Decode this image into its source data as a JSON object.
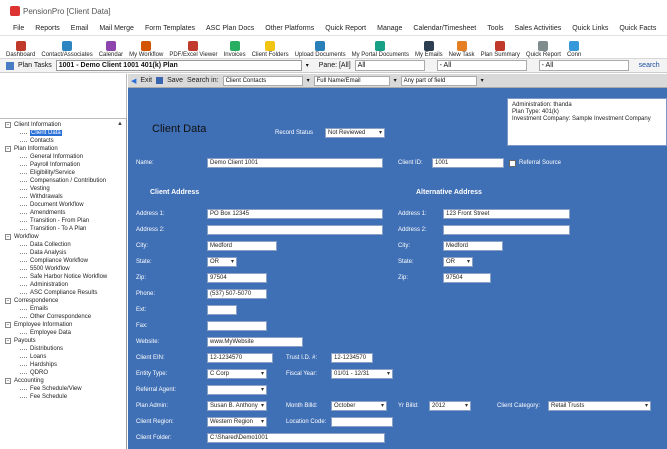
{
  "window": {
    "title": "PensionPro  [Client Data]"
  },
  "menu": [
    "File",
    "Reports",
    "Email",
    "Mail Merge",
    "Form Templates",
    "ASC Plan Docs",
    "Other Platforms",
    "Quick Report",
    "Manage",
    "Calendar/Timesheet",
    "Tools",
    "Sales Activities",
    "Quick Links",
    "Quick Facts"
  ],
  "toolbar": [
    {
      "label": "Dashboard",
      "icon": "dashboard-icon",
      "color": "#c0392b"
    },
    {
      "label": "Contact/Associates",
      "icon": "contacts-icon",
      "color": "#2e86c1"
    },
    {
      "label": "Calendar",
      "icon": "calendar-icon",
      "color": "#8e44ad"
    },
    {
      "label": "My Workflow",
      "icon": "workflow-icon",
      "color": "#d35400"
    },
    {
      "label": "PDF/Excel Viewer",
      "icon": "pdf-icon",
      "color": "#c0392b"
    },
    {
      "label": "Invoices",
      "icon": "invoice-icon",
      "color": "#27ae60"
    },
    {
      "label": "Client Folders",
      "icon": "folder-icon",
      "color": "#f1c40f"
    },
    {
      "label": "Upload Documents",
      "icon": "upload-icon",
      "color": "#2980b9"
    },
    {
      "label": "My Portal Documents",
      "icon": "portal-icon",
      "color": "#16a085"
    },
    {
      "label": "My Emails",
      "icon": "email-icon",
      "color": "#2c3e50"
    },
    {
      "label": "New Task",
      "icon": "task-icon",
      "color": "#e67e22"
    },
    {
      "label": "Plan Summary",
      "icon": "summary-icon",
      "color": "#c0392b"
    },
    {
      "label": "Quick Report",
      "icon": "report-icon",
      "color": "#7f8c8d"
    },
    {
      "label": "Conn",
      "icon": "connect-icon",
      "color": "#3498db"
    }
  ],
  "planbar": {
    "plan_label": "Plan Tasks",
    "plan_value": "1001 - Demo Client 1001 401(k) Plan",
    "pane_label": "Pane: [All]",
    "pane_value": "All",
    "filter1": "- All",
    "filter2": "- All",
    "search_link": "search"
  },
  "actions": {
    "exit": "Exit",
    "save": "Save",
    "search_in": "Search in:",
    "search_in_value": "Client Contacts",
    "name_field": "Full Name/Email",
    "match": "Any part of field"
  },
  "tree": [
    {
      "label": "Client Information",
      "level": 0,
      "expanded": true
    },
    {
      "label": "Client Data",
      "level": 1,
      "selected": true
    },
    {
      "label": "Contacts",
      "level": 1
    },
    {
      "label": "Plan Information",
      "level": 0,
      "expanded": true
    },
    {
      "label": "General Information",
      "level": 1
    },
    {
      "label": "Payroll Information",
      "level": 1
    },
    {
      "label": "Eligibility/Service",
      "level": 1
    },
    {
      "label": "Compensation / Contribution",
      "level": 1
    },
    {
      "label": "Vesting",
      "level": 1
    },
    {
      "label": "Withdrawals",
      "level": 1
    },
    {
      "label": "Document Workflow",
      "level": 1
    },
    {
      "label": "Amendments",
      "level": 1
    },
    {
      "label": "Transition - From Plan",
      "level": 1
    },
    {
      "label": "Transition - To A Plan",
      "level": 1
    },
    {
      "label": "Workflow",
      "level": 0,
      "expanded": true
    },
    {
      "label": "Data Collection",
      "level": 1
    },
    {
      "label": "Data Analysis",
      "level": 1
    },
    {
      "label": "Compliance Workflow",
      "level": 1
    },
    {
      "label": "5500 Workflow",
      "level": 1
    },
    {
      "label": "Safe Harbor Notice Workflow",
      "level": 1
    },
    {
      "label": "Administration",
      "level": 1
    },
    {
      "label": "ASC Compliance Results",
      "level": 1
    },
    {
      "label": "Correspondence",
      "level": 0,
      "expanded": true
    },
    {
      "label": "Emails",
      "level": 1
    },
    {
      "label": "Other Correspondence",
      "level": 1
    },
    {
      "label": "Employee Information",
      "level": 0,
      "expanded": true
    },
    {
      "label": "Employee Data",
      "level": 1
    },
    {
      "label": "Payouts",
      "level": 0,
      "expanded": true
    },
    {
      "label": "Distributions",
      "level": 1
    },
    {
      "label": "Loans",
      "level": 1
    },
    {
      "label": "Hardships",
      "level": 1
    },
    {
      "label": "QDRO",
      "level": 1
    },
    {
      "label": "Accounting",
      "level": 0,
      "expanded": true
    },
    {
      "label": "Fee Schedule/View",
      "level": 1
    },
    {
      "label": "Fee Schedule",
      "level": 1
    }
  ],
  "summary": {
    "line1": "Administration: thanda",
    "line2": "Plan Type: 401(k)",
    "line3": "Investment Company: Sample Investment Company"
  },
  "form": {
    "page_title": "Client Data",
    "record_status_label": "Record Status",
    "record_status": "Not Reviewed",
    "name_label": "Name:",
    "name": "Demo Client 1001",
    "client_id_label": "Client ID:",
    "client_id": "1001",
    "referral_label": "Referral Source",
    "client_address_heading": "Client Address",
    "alt_address_heading": "Alternative Address",
    "address1_label": "Address 1:",
    "address1": "PO Box 12345",
    "address2_label": "Address 2:",
    "address2": "",
    "city_label": "City:",
    "city": "Medford",
    "state_label": "State:",
    "state": "OR",
    "zip_label": "Zip:",
    "zip": "97504",
    "phone_label": "Phone:",
    "phone": "(537) 507-5070",
    "ext_label": "Ext:",
    "ext": "",
    "fax_label": "Fax:",
    "fax": "",
    "website_label": "Website:",
    "website": "www.MyWebsite",
    "alt_address1_label": "Address 1:",
    "alt_address1": "123 Front Street",
    "alt_address2_label": "Address 2:",
    "alt_address2": "",
    "alt_city_label": "City:",
    "alt_city": "Medford",
    "alt_state_label": "State:",
    "alt_state": "OR",
    "alt_zip_label": "Zip:",
    "alt_zip": "97504",
    "client_ein_label": "Client EIN:",
    "client_ein": "12-1234570",
    "trust_ein_label": "Trust I.D. #:",
    "trust_ein": "12-1234570",
    "entity_type_label": "Entity Type:",
    "entity_type": "C Corp",
    "fiscal_year_label": "Fiscal Year:",
    "fiscal_year": "01/01 - 12/31",
    "referral_agent_label": "Referral Agent:",
    "referral_agent": "",
    "plan_admin_label": "Plan Admin:",
    "plan_admin": "Susan B. Anthony",
    "month_label": "Month Billd:",
    "month": "October",
    "yr_label": "Yr Billd:",
    "yr": "2012",
    "client_category_label": "Client Category:",
    "client_category": "Retail Trusts",
    "client_region_label": "Client Region:",
    "client_region": "Western Region",
    "location_code_label": "Location Code:",
    "location_code": "",
    "client_folder_label": "Client Folder:",
    "client_folder": "C:\\Shared\\Demo1001"
  }
}
